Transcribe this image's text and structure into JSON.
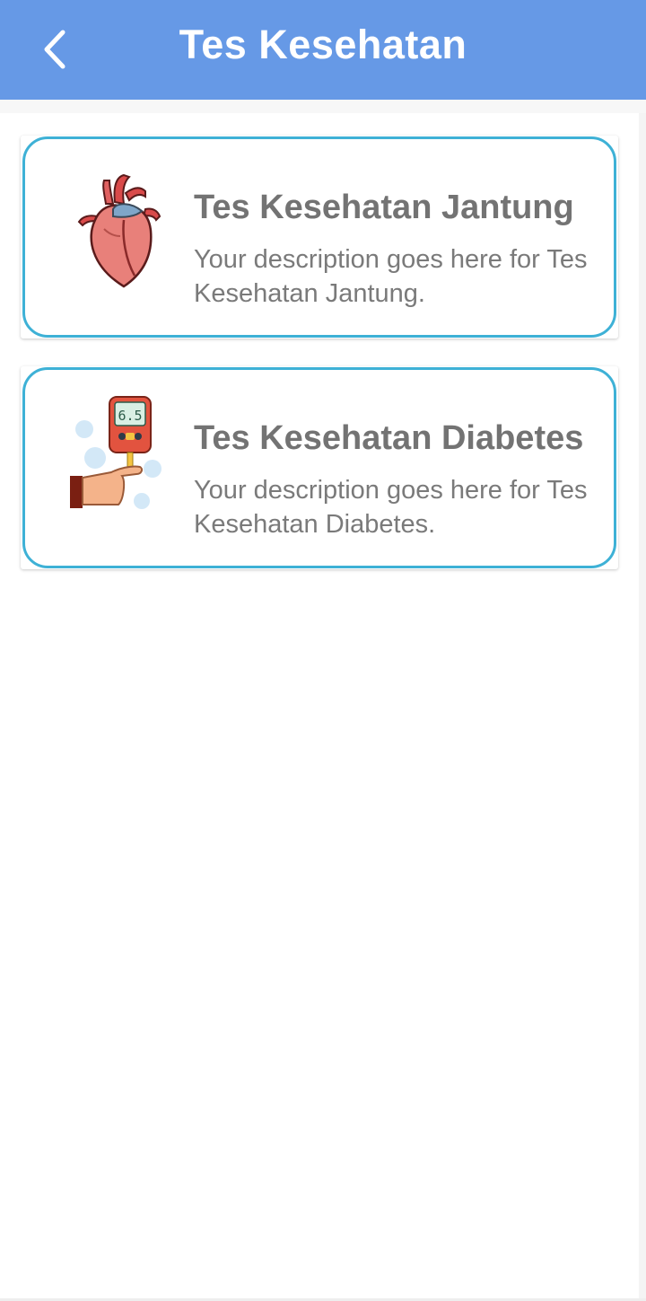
{
  "header": {
    "title": "Tes Kesehatan",
    "back_icon": "chevron-left-icon",
    "bg_color": "#6699e6"
  },
  "cards": [
    {
      "title": "Tes Kesehatan Jantung",
      "description": "Your description goes here for Tes Kesehatan Jantung.",
      "image": "heart-illustration"
    },
    {
      "title": "Tes Kesehatan Diabetes",
      "description": "Your description goes here for Tes Kesehatan Diabetes.",
      "image": "glucose-meter-illustration",
      "meter_reading": "6.5"
    }
  ],
  "colors": {
    "card_border": "#3eb1d6",
    "text": "#737373"
  }
}
